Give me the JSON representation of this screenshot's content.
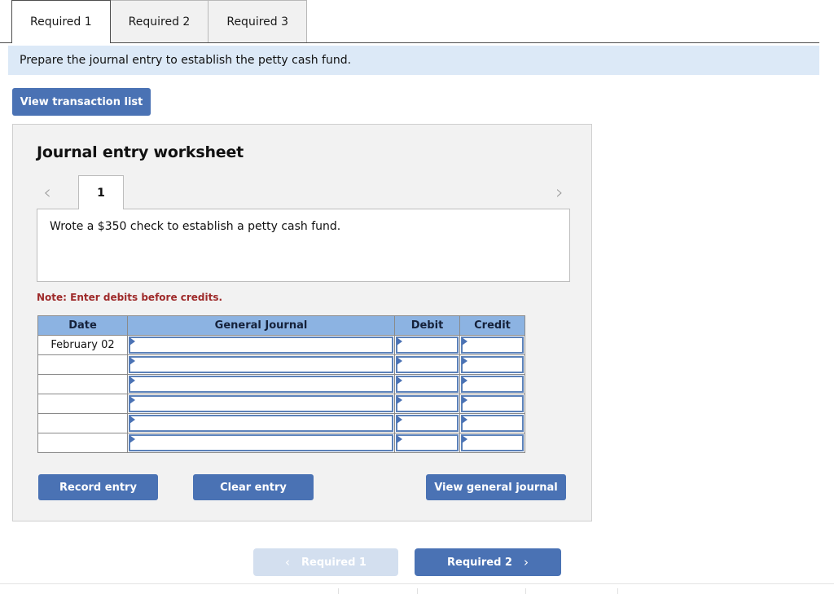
{
  "tabs": [
    {
      "label": "Required 1",
      "active": true
    },
    {
      "label": "Required 2",
      "active": false
    },
    {
      "label": "Required 3",
      "active": false
    }
  ],
  "instruction": {
    "text": "Prepare the journal entry to establish the petty cash fund."
  },
  "toolbar": {
    "view_transaction_list_label": "View transaction list"
  },
  "worksheet": {
    "title": "Journal entry worksheet",
    "pager": {
      "prev_icon": "chevron-left",
      "next_icon": "chevron-right",
      "current_page": "1"
    },
    "description": "Wrote a $350 check to establish a petty cash fund.",
    "note": "Note: Enter debits before credits.",
    "table": {
      "headers": [
        "Date",
        "General Journal",
        "Debit",
        "Credit"
      ],
      "rows": [
        {
          "date": "February 02",
          "general_journal": "",
          "debit": "",
          "credit": ""
        },
        {
          "date": "",
          "general_journal": "",
          "debit": "",
          "credit": ""
        },
        {
          "date": "",
          "general_journal": "",
          "debit": "",
          "credit": ""
        },
        {
          "date": "",
          "general_journal": "",
          "debit": "",
          "credit": ""
        },
        {
          "date": "",
          "general_journal": "",
          "debit": "",
          "credit": ""
        },
        {
          "date": "",
          "general_journal": "",
          "debit": "",
          "credit": ""
        }
      ]
    },
    "actions": {
      "record_entry_label": "Record entry",
      "clear_entry_label": "Clear entry",
      "view_general_journal_label": "View general journal"
    }
  },
  "bottom_nav": {
    "prev_label": "Required 1",
    "prev_icon": "chevron-left",
    "prev_disabled": true,
    "next_label": "Required 2",
    "next_icon": "chevron-right"
  },
  "colors": {
    "primary_button": "#4a72b4",
    "disabled_button": "#d3dfef",
    "table_header": "#8cb3e2",
    "instruction_bar": "#dce9f7",
    "panel_bg": "#f2f2f2",
    "note_text": "#9e2a2a",
    "input_border": "#5b81b9"
  }
}
